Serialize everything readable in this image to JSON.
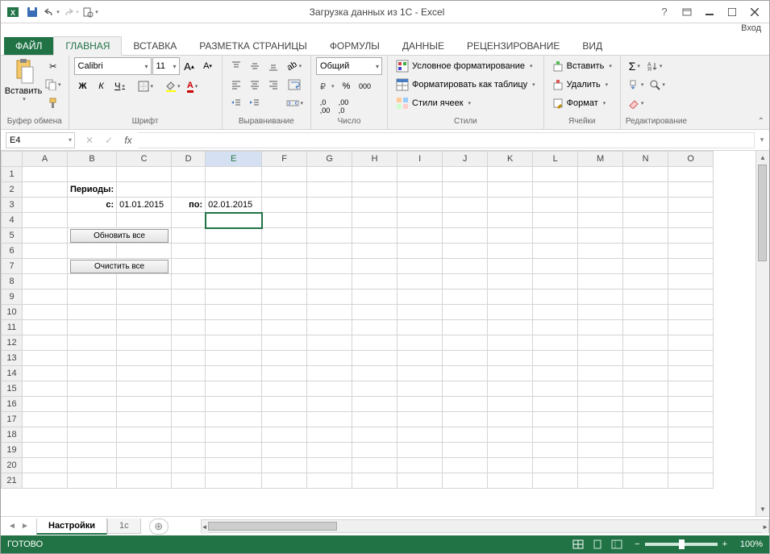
{
  "title": "Загрузка данных из 1С - Excel",
  "signin": "Вход",
  "tabs": {
    "file": "ФАЙЛ",
    "home": "ГЛАВНАЯ",
    "insert": "ВСТАВКА",
    "layout": "РАЗМЕТКА СТРАНИЦЫ",
    "formulas": "ФОРМУЛЫ",
    "data": "ДАННЫЕ",
    "review": "РЕЦЕНЗИРОВАНИЕ",
    "view": "ВИД"
  },
  "ribbon": {
    "clipboard": {
      "label": "Буфер обмена",
      "paste": "Вставить"
    },
    "font": {
      "label": "Шрифт",
      "name": "Calibri",
      "size": "11",
      "bold": "Ж",
      "italic": "К",
      "underline": "Ч"
    },
    "align": {
      "label": "Выравнивание"
    },
    "number": {
      "label": "Число",
      "format": "Общий"
    },
    "styles": {
      "label": "Стили",
      "cond": "Условное форматирование",
      "table": "Форматировать как таблицу",
      "cell": "Стили ячеек"
    },
    "cells": {
      "label": "Ячейки",
      "insert": "Вставить",
      "delete": "Удалить",
      "format": "Формат"
    },
    "editing": {
      "label": "Редактирование"
    }
  },
  "namebox": "E4",
  "formula": "",
  "columns": [
    "A",
    "B",
    "C",
    "D",
    "E",
    "F",
    "G",
    "H",
    "I",
    "J",
    "K",
    "L",
    "M",
    "N",
    "O"
  ],
  "rows": [
    "1",
    "2",
    "3",
    "4",
    "5",
    "6",
    "7",
    "8",
    "9",
    "10",
    "11",
    "12",
    "13",
    "14",
    "15",
    "16",
    "17",
    "18",
    "19",
    "20",
    "21"
  ],
  "cells": {
    "B2": "Периоды:",
    "B3": "с:",
    "C3": "01.01.2015",
    "D3": "по:",
    "E3": "02.01.2015",
    "btn5": "Обновить все",
    "btn7": "Очистить все"
  },
  "sheets": {
    "active": "Настройки",
    "other": "1с"
  },
  "status": {
    "ready": "ГОТОВО",
    "zoom": "100%"
  }
}
